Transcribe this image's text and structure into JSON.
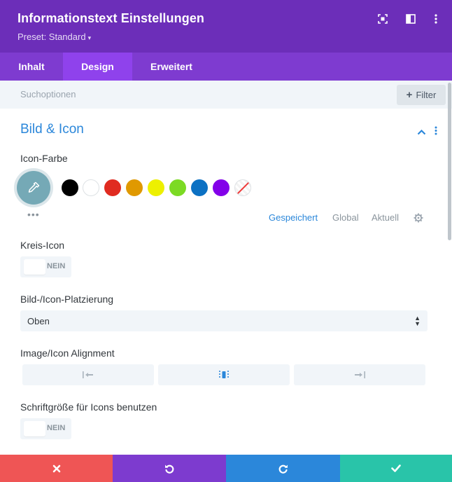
{
  "header": {
    "title": "Informationstext Einstellungen",
    "preset": "Preset: Standard",
    "preset_caret": "▾",
    "icons": [
      "focus-icon",
      "split-view-icon",
      "more-vertical-icon"
    ]
  },
  "tabs": [
    {
      "label": "Inhalt",
      "active": false
    },
    {
      "label": "Design",
      "active": true
    },
    {
      "label": "Erweitert",
      "active": false
    }
  ],
  "search": {
    "placeholder": "Suchoptionen",
    "filter_label": "Filter"
  },
  "section": {
    "title": "Bild & Icon",
    "expanded": true
  },
  "icon_color": {
    "label": "Icon-Farbe",
    "selected_color": "#75a9b6",
    "swatches": [
      "#000000",
      "#ffffff",
      "#e02b20",
      "#e09900",
      "#edf000",
      "#7cda24",
      "#0c71c3",
      "#8300e9",
      "none"
    ],
    "more": "•••",
    "palette_tabs": [
      {
        "label": "Gespeichert",
        "active": true
      },
      {
        "label": "Global",
        "active": false
      },
      {
        "label": "Aktuell",
        "active": false
      }
    ]
  },
  "kreis_icon": {
    "label": "Kreis-Icon",
    "toggle_text": "NEIN",
    "value": false
  },
  "placement": {
    "label": "Bild-/Icon-Platzierung",
    "value": "Oben"
  },
  "alignment": {
    "label": "Image/Icon Alignment",
    "options": [
      "align-left-icon",
      "align-center-icon",
      "align-right-icon"
    ],
    "selected": "align-center-icon"
  },
  "icon_font_size": {
    "label": "Schriftgröße für Icons benutzen",
    "toggle_text": "NEIN",
    "value": false
  },
  "footer": {
    "buttons": [
      {
        "name": "discard",
        "icon": "close-icon",
        "color": "#ef5555"
      },
      {
        "name": "undo",
        "icon": "undo-icon",
        "color": "#7d3bcf"
      },
      {
        "name": "redo",
        "icon": "redo-icon",
        "color": "#2b87da"
      },
      {
        "name": "save",
        "icon": "check-icon",
        "color": "#29c4a9"
      }
    ]
  },
  "colors": {
    "header_bg": "#6c2eb9",
    "tabs_bg": "#7e3bd0",
    "tab_active_bg": "#8f42ec",
    "accent_blue": "#2b87da",
    "field_bg": "#f1f5f9"
  }
}
